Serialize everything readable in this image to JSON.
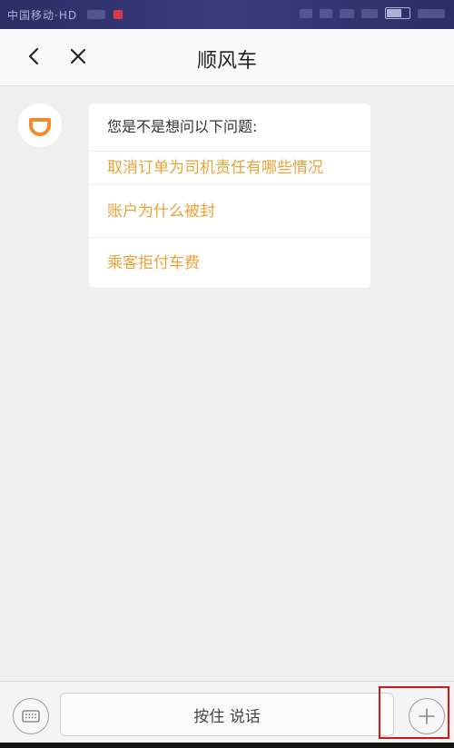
{
  "status_bar": {
    "carrier": "中国移动·HD",
    "battery_percent": 73,
    "time": ""
  },
  "header": {
    "title": "顺风车",
    "back_icon": "chevron-left-icon",
    "close_icon": "close-icon"
  },
  "chat": {
    "avatar_icon": "didi-logo-icon",
    "bubble_title": "您是不是想问以下问题:",
    "options": [
      {
        "label": "取消订单为司机责任有哪些情况"
      },
      {
        "label": "账户为什么被封"
      },
      {
        "label": "乘客拒付车费"
      }
    ]
  },
  "input_bar": {
    "keyboard_icon": "keyboard-icon",
    "voice_label": "按住 说话",
    "plus_icon": "plus-icon"
  },
  "colors": {
    "accent": "#e9a338",
    "brand_orange": "#f08a2c",
    "highlight_red": "#d01818"
  }
}
